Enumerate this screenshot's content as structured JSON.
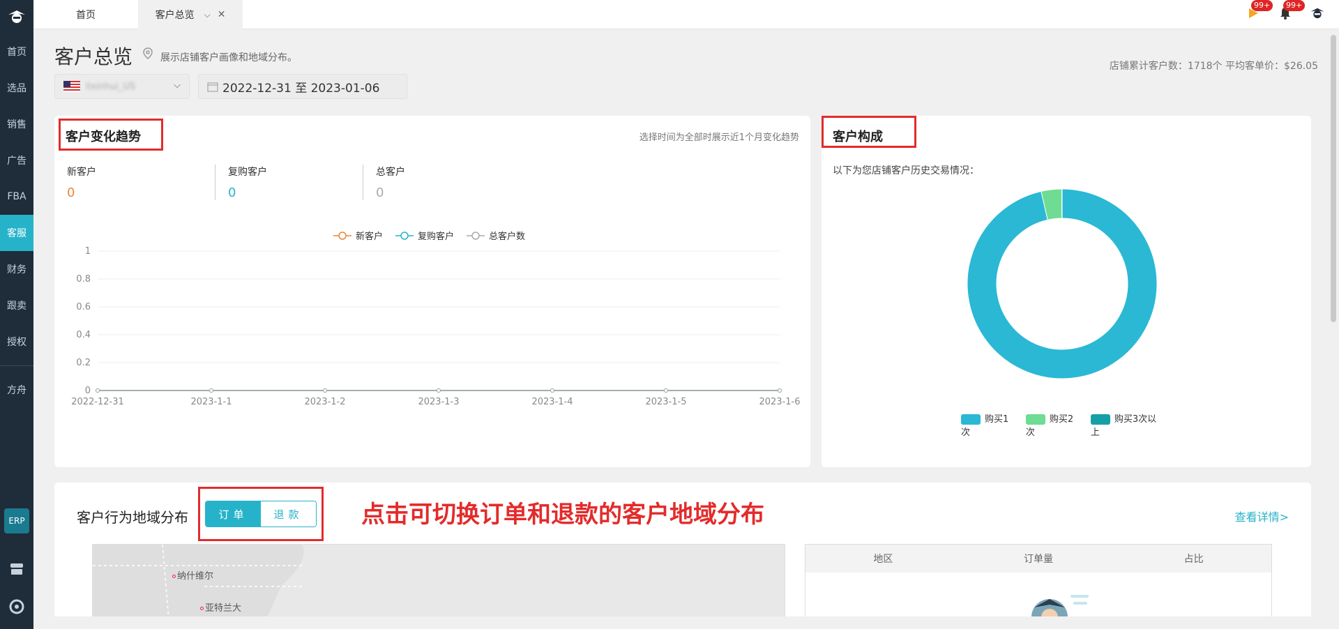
{
  "sidebar": {
    "items": [
      {
        "label": "首页"
      },
      {
        "label": "选品"
      },
      {
        "label": "销售"
      },
      {
        "label": "广告"
      },
      {
        "label": "FBA"
      },
      {
        "label": "客服"
      },
      {
        "label": "财务"
      },
      {
        "label": "跟卖"
      },
      {
        "label": "授权"
      },
      {
        "label": "方舟"
      }
    ],
    "active": "客服",
    "erp_label": "ERP"
  },
  "tabs": {
    "home": "首页",
    "current": "客户总览"
  },
  "notifications": {
    "flag_badge": "99+",
    "bell_badge": "99+"
  },
  "header": {
    "title": "客户总览",
    "description": "展示店铺客户画像和地域分布。",
    "store_stats": "店铺累计客户数：1718个 平均客单价：$26.05",
    "store_name": "lixinhui_US",
    "date_range": "2022-12-31 至 2023-01-06"
  },
  "trend_card": {
    "title": "客户变化趋势",
    "hint": "选择时间为全部时展示近1个月变化趋势",
    "metrics": [
      {
        "label": "新客户",
        "value": "0",
        "color": "#e8863a"
      },
      {
        "label": "复购客户",
        "value": "0",
        "color": "#26b3c9"
      },
      {
        "label": "总客户",
        "value": "0",
        "color": "#aaaaaa"
      }
    ]
  },
  "composition_card": {
    "title": "客户构成",
    "description": "以下为您店铺客户历史交易情况："
  },
  "geo_card": {
    "title": "客户行为地域分布",
    "toggle_orders": "订单",
    "toggle_refunds": "退款",
    "annotation": "点击可切换订单和退款的客户地域分布",
    "details_link": "查看详情>",
    "map_cities": [
      "纳什维尔",
      "亚特兰大"
    ],
    "table_headers": [
      "地区",
      "订单量",
      "占比"
    ]
  },
  "chart_data": [
    {
      "type": "line",
      "x": [
        "2022-12-31",
        "2023-1-1",
        "2023-1-2",
        "2023-1-3",
        "2023-1-4",
        "2023-1-5",
        "2023-1-6"
      ],
      "series": [
        {
          "name": "新客户",
          "values": [
            0,
            0,
            0,
            0,
            0,
            0,
            0
          ],
          "color": "#e8863a"
        },
        {
          "name": "复购客户",
          "values": [
            0,
            0,
            0,
            0,
            0,
            0,
            0
          ],
          "color": "#26b3c9"
        },
        {
          "name": "总客户数",
          "values": [
            0,
            0,
            0,
            0,
            0,
            0,
            0
          ],
          "color": "#aaaaaa"
        }
      ],
      "yticks": [
        "0",
        "0.2",
        "0.4",
        "0.6",
        "0.8",
        "1"
      ],
      "ylim": [
        0,
        1
      ],
      "grid": true,
      "legend": "top-center"
    },
    {
      "type": "pie",
      "donut": true,
      "labels": [
        "购买1次",
        "购买2次",
        "购买3次以上"
      ],
      "values": [
        96.5,
        3.5,
        0.05
      ],
      "colors": [
        "#2ab8d4",
        "#6edc92",
        "#15a0a8"
      ],
      "legend": "bottom"
    }
  ]
}
